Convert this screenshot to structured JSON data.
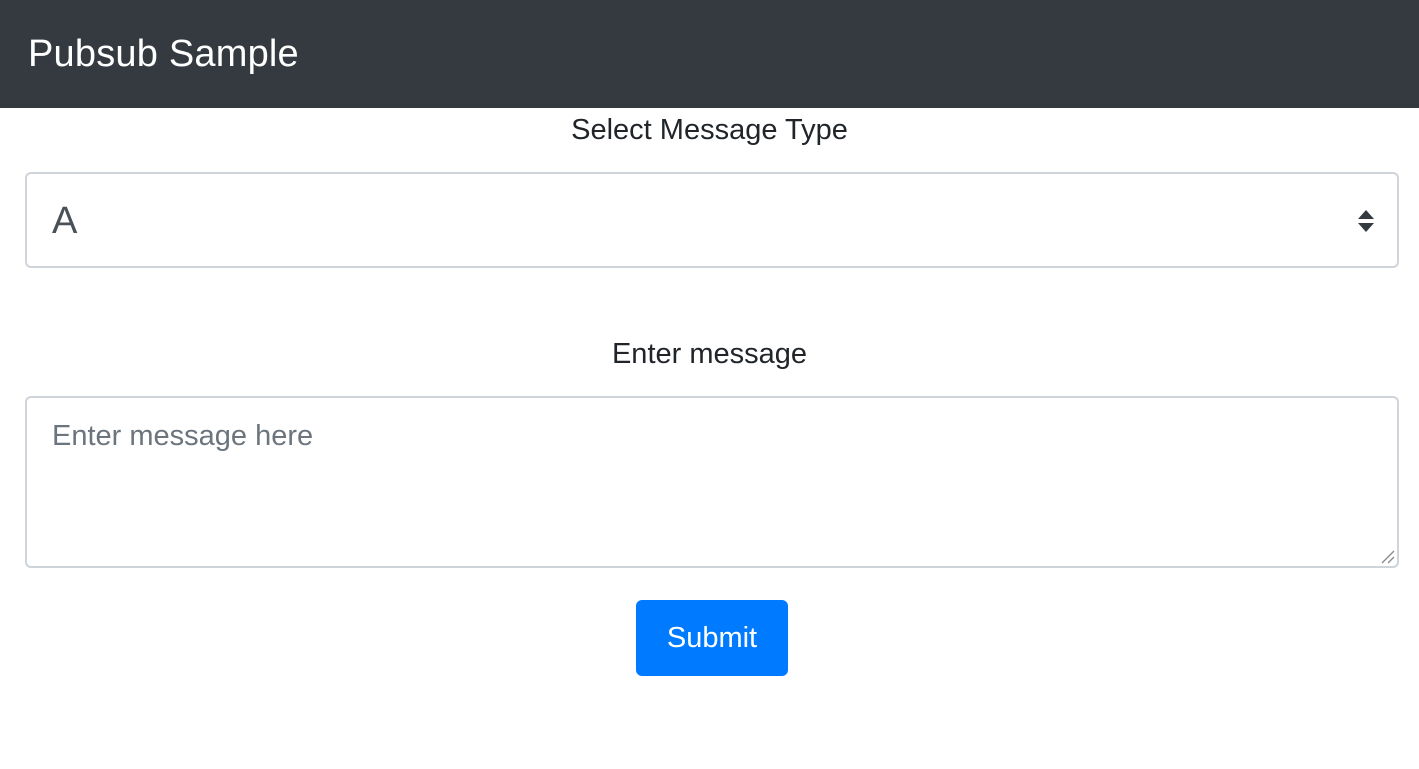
{
  "navbar": {
    "brand": "Pubsub Sample",
    "background_color": "#343a40"
  },
  "message_type": {
    "label": "Select Message Type",
    "selected_value": "A",
    "icon": "select-updown-arrows-icon"
  },
  "message": {
    "label": "Enter message",
    "value": "",
    "placeholder": "Enter message here",
    "icon": "resize-handle-icon"
  },
  "submit": {
    "label": "Submit",
    "color": "#007bff"
  }
}
